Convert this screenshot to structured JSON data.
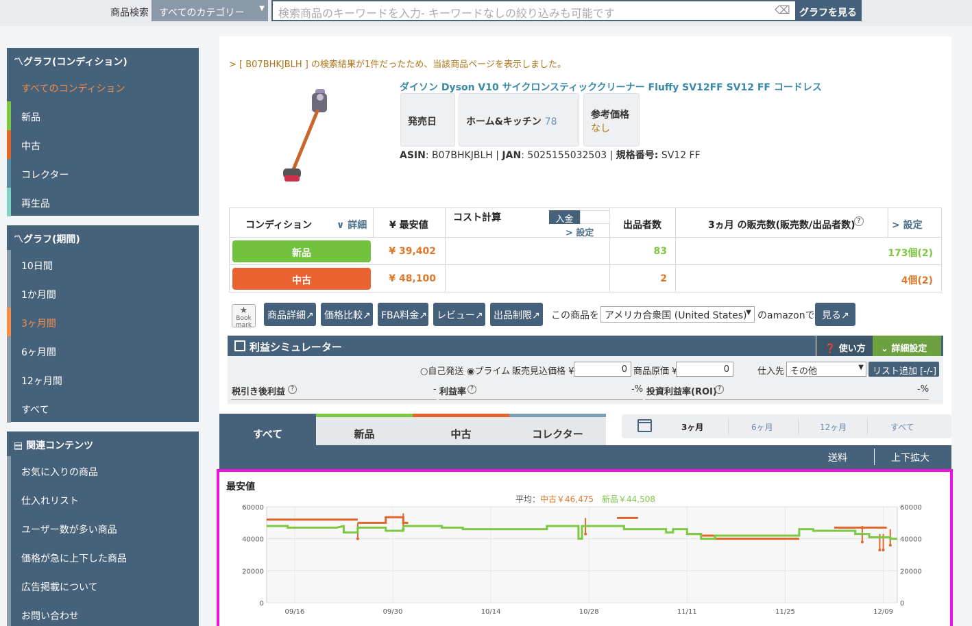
{
  "topbar": {
    "search_label": "商品検索",
    "category": "すべてのカテゴリー",
    "search_placeholder": "検索商品のキーワードを入力- キーワードなしの絞り込みも可能です",
    "graph_button": "グラフを見る"
  },
  "sidebar": {
    "condition_title": "〽グラフ(コンディション)",
    "condition_items": [
      {
        "label": "すべてのコンディション",
        "color": ""
      },
      {
        "label": "新品",
        "color": "#7cc843"
      },
      {
        "label": "中古",
        "color": "#e0672c"
      },
      {
        "label": "コレクター",
        "color": "#5a8aa0"
      },
      {
        "label": "再生品",
        "color": "#7fd3c3"
      }
    ],
    "period_title": "〽グラフ(期間)",
    "period_items": [
      "10日間",
      "1か月間",
      "3ヶ月間",
      "6ヶ月間",
      "12ヶ月間",
      "すべて"
    ],
    "related_title": "関連コンテンツ",
    "related_items": [
      "お気に入りの商品",
      "仕入れリスト",
      "ユーザー数が多い商品",
      "価格が急に上下した商品",
      "広告掲載について",
      "お問い合わせ"
    ]
  },
  "product": {
    "notice": "> [ B07BHKJBLH ] の検索結果が1件だったため、当該商品ページを表示しました。",
    "title": "ダイソン Dyson V10 サイクロンスティッククリーナー Fluffy SV12FF SV12 FF コードレス",
    "release_label": "発売日",
    "category_label": "ホーム&キッチン",
    "category_rank": "78",
    "ref_price_label": "参考価格",
    "ref_price_value": "なし",
    "asin_label": "ASIN",
    "asin": ": B07BHKJBLH | ",
    "jan_label": "JAN",
    "jan": ": 5025155032503 | ",
    "model_label": "規格番号:",
    "model": " SV12 FF"
  },
  "table": {
    "headers": {
      "condition": "コンディション",
      "detail": "∨ 詳細",
      "min_price": "¥ 最安値",
      "cost": "コスト計算",
      "deposit": "入金",
      "cost_setting": "> 設定",
      "sellers": "出品者数",
      "sales": "3ヵ月 の販売数(販売数/出品者数)",
      "help": "?",
      "sales_setting": "> 設定"
    },
    "rows": [
      {
        "condition": "新品",
        "price": "¥ 39,402",
        "sellers": "83",
        "sales": "173個(2)"
      },
      {
        "condition": "中古",
        "price": "¥ 48,100",
        "sellers": "2",
        "sales": "4個(2)"
      }
    ]
  },
  "buttons": {
    "bookmark": "Book mark",
    "detail": "商品詳細",
    "compare": "価格比較",
    "fba": "FBA料金",
    "review": "レビュー",
    "restrict": "出品制限",
    "this_product": "この商品を",
    "country": "アメリカ合衆国 (United States)",
    "on_amazon": "のamazonで",
    "view": "見る"
  },
  "simulator": {
    "title": "利益シミュレーター",
    "how": "使い方",
    "detail": "詳細設定",
    "self_ship": "自己発送",
    "prime": "プライム",
    "expected_price_label": "販売見込価格 ¥",
    "expected_price": "0",
    "cost_label": "商品原価 ¥",
    "cost": "0",
    "supplier_label": "仕入先",
    "supplier": "その他",
    "list_add": "リスト追加 [-/-]",
    "profit_label": "税引き後利益",
    "profit_value": "-",
    "margin_label": "利益率",
    "margin_value": "-%",
    "roi_label": "投資利益率(ROI)",
    "roi_value": "-%"
  },
  "tabs": [
    {
      "label": "すべて",
      "stripe": ""
    },
    {
      "label": "新品",
      "stripe": "#7cc843"
    },
    {
      "label": "中古",
      "stripe": "#e0672c"
    },
    {
      "label": "コレクター",
      "stripe": "#7a9fb3"
    }
  ],
  "period_tabs": [
    "3ヶ月",
    "6ヶ月",
    "12ヶ月",
    "すべて"
  ],
  "chart_nav": {
    "shipping": "送料",
    "zoom": "上下拡大"
  },
  "chart_data": {
    "type": "line",
    "title": "最安値",
    "average_label": "平均：",
    "average_used": "中古￥46,475",
    "average_new": "新品￥44,508",
    "x_ticks": [
      "09/16",
      "09/30",
      "10/14",
      "10/28",
      "11/11",
      "11/25",
      "12/09"
    ],
    "y_ticks": [
      0,
      20000,
      40000,
      60000
    ],
    "ylim": [
      0,
      60000
    ],
    "x_range_days": [
      0,
      90
    ],
    "series": [
      {
        "name": "中古",
        "color": "#e0672c",
        "points": [
          [
            0,
            52000
          ],
          [
            13,
            52000
          ],
          [
            13,
            50000
          ],
          [
            17,
            50000
          ],
          [
            17,
            52000
          ],
          [
            18,
            52000
          ],
          [
            18,
            54000
          ],
          [
            19.5,
            54000
          ],
          [
            19.5,
            50000
          ],
          [
            20,
            50000
          ],
          [
            20,
            52000
          ],
          [
            20.2,
            52000
          ]
        ],
        "segments": [
          [
            [
              0,
              52000
            ],
            [
              13,
              52000
            ]
          ],
          [
            [
              13,
              50000
            ],
            [
              17,
              50000
            ],
            [
              17,
              53500
            ],
            [
              19.5,
              53500
            ],
            [
              19.5,
              50000
            ],
            [
              20.2,
              50000
            ]
          ],
          [
            [
              50,
              53000
            ],
            [
              53,
              53000
            ]
          ],
          [
            [
              60,
              43000
            ],
            [
              62,
              43000
            ],
            [
              62,
              42000
            ],
            [
              64,
              42000
            ],
            [
              64,
              40000
            ],
            [
              76,
              40000
            ]
          ],
          [
            [
              81,
              47000
            ],
            [
              88.5,
              47000
            ]
          ]
        ],
        "spikes": [
          [
            13,
            40000
          ],
          [
            19.5,
            46000
          ],
          [
            45.5,
            43000
          ],
          [
            85,
            38000
          ],
          [
            87.5,
            33000
          ],
          [
            88,
            33000
          ],
          [
            89,
            36000
          ]
        ]
      },
      {
        "name": "新品",
        "color": "#7cc843",
        "segments": [
          [
            [
              0,
              48000
            ],
            [
              3,
              48000
            ],
            [
              3,
              47000
            ],
            [
              10,
              47000
            ],
            [
              11,
              48000
            ],
            [
              11,
              44000
            ],
            [
              13,
              44000
            ],
            [
              13,
              47000
            ],
            [
              17,
              47000
            ],
            [
              17,
              45000
            ],
            [
              19.5,
              45000
            ],
            [
              19.5,
              48000
            ],
            [
              25,
              48000
            ],
            [
              25,
              47000
            ],
            [
              28,
              47000
            ],
            [
              28,
              46000
            ],
            [
              40,
              46000
            ],
            [
              40,
              48000
            ],
            [
              44.5,
              48000
            ],
            [
              44.5,
              40000
            ],
            [
              45,
              40000
            ],
            [
              45,
              48000
            ],
            [
              51,
              48000
            ],
            [
              51,
              46000
            ],
            [
              57,
              46000
            ],
            [
              57,
              44000
            ],
            [
              58,
              44000
            ],
            [
              58,
              46000
            ],
            [
              60,
              46000
            ],
            [
              60,
              43000
            ],
            [
              62,
              43000
            ],
            [
              62,
              40000
            ],
            [
              64,
              40000
            ],
            [
              64,
              42000
            ],
            [
              76,
              42000
            ],
            [
              76,
              46000
            ],
            [
              78,
              46000
            ],
            [
              78,
              45000
            ],
            [
              84,
              45000
            ],
            [
              84,
              43000
            ],
            [
              86,
              43000
            ],
            [
              86,
              41000
            ],
            [
              89,
              41000
            ],
            [
              89,
              40000
            ],
            [
              90,
              40000
            ]
          ]
        ]
      }
    ]
  }
}
